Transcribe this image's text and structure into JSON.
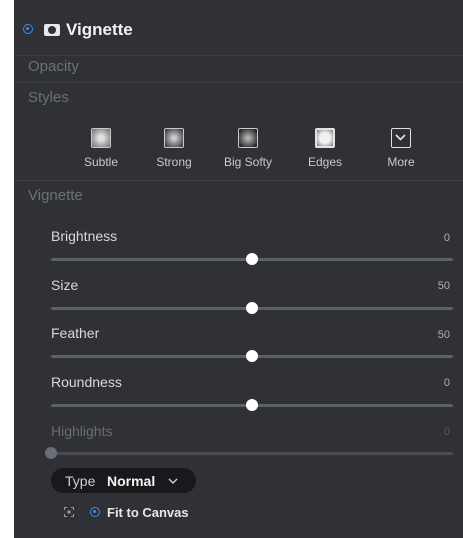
{
  "header": {
    "title": "Vignette",
    "enabled": true,
    "accent_color": "#3b8eea"
  },
  "sections": {
    "opacity_label": "Opacity",
    "styles_label": "Styles",
    "vignette_label": "Vignette"
  },
  "styles": [
    {
      "label": "Subtle",
      "icon": "subtle-preset-icon"
    },
    {
      "label": "Strong",
      "icon": "strong-preset-icon"
    },
    {
      "label": "Big Softy",
      "icon": "big-softy-preset-icon"
    },
    {
      "label": "Edges",
      "icon": "edges-preset-icon"
    },
    {
      "label": "More",
      "icon": "chevron-down-box-icon"
    }
  ],
  "sliders": [
    {
      "label": "Brightness",
      "value": "0",
      "min": -100,
      "max": 100,
      "numeric": 0,
      "centered": true,
      "enabled": true
    },
    {
      "label": "Size",
      "value": "50",
      "min": 0,
      "max": 100,
      "numeric": 50,
      "centered": false,
      "enabled": true
    },
    {
      "label": "Feather",
      "value": "50",
      "min": 0,
      "max": 100,
      "numeric": 50,
      "centered": false,
      "enabled": true
    },
    {
      "label": "Roundness",
      "value": "0",
      "min": -100,
      "max": 100,
      "numeric": 0,
      "centered": true,
      "enabled": true
    },
    {
      "label": "Highlights",
      "value": "0",
      "min": 0,
      "max": 100,
      "numeric": 0,
      "centered": false,
      "enabled": false
    }
  ],
  "type_dropdown": {
    "label": "Type",
    "value": "Normal"
  },
  "fit_to_canvas": {
    "label": "Fit to Canvas",
    "checked": true
  }
}
